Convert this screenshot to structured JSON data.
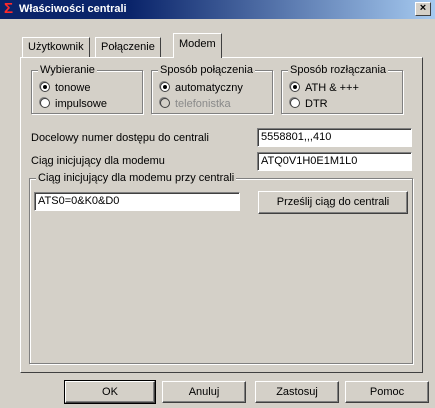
{
  "window": {
    "title": "Właściwości centrali",
    "close_label": "×",
    "icon": "sigma-icon"
  },
  "tabs": [
    {
      "label": "Użytkownik",
      "active": false
    },
    {
      "label": "Połączenie",
      "active": false
    },
    {
      "label": "Modem",
      "active": true
    }
  ],
  "groups": {
    "dialing": {
      "title": "Wybieranie",
      "options": [
        "tonowe",
        "impulsowe"
      ],
      "selected": "tonowe"
    },
    "connect": {
      "title": "Sposób połączenia",
      "options": [
        "automatyczny",
        "telefonistka"
      ],
      "selected": "automatyczny",
      "disabled": [
        "telefonistka"
      ]
    },
    "disconnect": {
      "title": "Sposób rozłączania",
      "options": [
        "ATH & +++",
        "DTR"
      ],
      "selected": "ATH & +++"
    }
  },
  "fields": {
    "access_number": {
      "label": "Docelowy numer dostępu do centrali",
      "value": "5558801,,,410"
    },
    "modem_init": {
      "label": "Ciąg inicjujący dla modemu",
      "value": "ATQ0V1H0E1M1L0"
    }
  },
  "central_init": {
    "title": "Ciąg inicjujący dla modemu przy centrali",
    "value": "ATS0=0&K0&D0",
    "send_button": "Prześlij ciąg do centrali"
  },
  "buttons": {
    "ok": "OK",
    "cancel": "Anuluj",
    "apply": "Zastosuj",
    "help": "Pomoc"
  }
}
